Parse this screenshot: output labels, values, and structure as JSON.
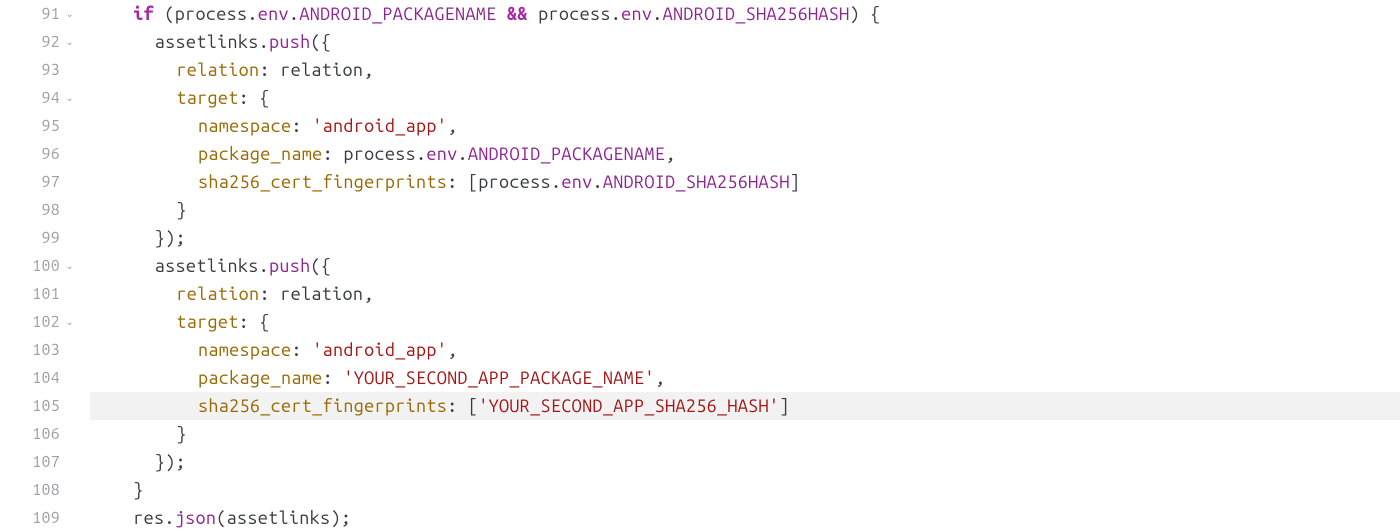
{
  "editor": {
    "highlighted_line": 105,
    "lines": [
      {
        "num": 91,
        "foldable": true,
        "indent": 4,
        "tokens": [
          {
            "t": "if",
            "c": "tok-kw"
          },
          {
            "t": " (",
            "c": "tok-pun"
          },
          {
            "t": "process",
            "c": "tok-id"
          },
          {
            "t": ".",
            "c": "tok-pun"
          },
          {
            "t": "env",
            "c": "tok-prop"
          },
          {
            "t": ".",
            "c": "tok-pun"
          },
          {
            "t": "ANDROID_PACKAGENAME",
            "c": "tok-env"
          },
          {
            "t": " ",
            "c": "tok-pun"
          },
          {
            "t": "&&",
            "c": "tok-op"
          },
          {
            "t": " ",
            "c": "tok-pun"
          },
          {
            "t": "process",
            "c": "tok-id"
          },
          {
            "t": ".",
            "c": "tok-pun"
          },
          {
            "t": "env",
            "c": "tok-prop"
          },
          {
            "t": ".",
            "c": "tok-pun"
          },
          {
            "t": "ANDROID_SHA256HASH",
            "c": "tok-env"
          },
          {
            "t": ") {",
            "c": "tok-pun"
          }
        ]
      },
      {
        "num": 92,
        "foldable": true,
        "indent": 6,
        "tokens": [
          {
            "t": "assetlinks",
            "c": "tok-id"
          },
          {
            "t": ".",
            "c": "tok-pun"
          },
          {
            "t": "push",
            "c": "tok-method"
          },
          {
            "t": "({",
            "c": "tok-pun"
          }
        ]
      },
      {
        "num": 93,
        "foldable": false,
        "indent": 8,
        "tokens": [
          {
            "t": "relation",
            "c": "tok-attr"
          },
          {
            "t": ": ",
            "c": "tok-pun"
          },
          {
            "t": "relation",
            "c": "tok-id"
          },
          {
            "t": ",",
            "c": "tok-pun"
          }
        ]
      },
      {
        "num": 94,
        "foldable": true,
        "indent": 8,
        "tokens": [
          {
            "t": "target",
            "c": "tok-attr"
          },
          {
            "t": ": {",
            "c": "tok-pun"
          }
        ]
      },
      {
        "num": 95,
        "foldable": false,
        "indent": 10,
        "tokens": [
          {
            "t": "namespace",
            "c": "tok-attr"
          },
          {
            "t": ": ",
            "c": "tok-pun"
          },
          {
            "t": "'android_app'",
            "c": "tok-str"
          },
          {
            "t": ",",
            "c": "tok-pun"
          }
        ]
      },
      {
        "num": 96,
        "foldable": false,
        "indent": 10,
        "tokens": [
          {
            "t": "package_name",
            "c": "tok-attr"
          },
          {
            "t": ": ",
            "c": "tok-pun"
          },
          {
            "t": "process",
            "c": "tok-id"
          },
          {
            "t": ".",
            "c": "tok-pun"
          },
          {
            "t": "env",
            "c": "tok-prop"
          },
          {
            "t": ".",
            "c": "tok-pun"
          },
          {
            "t": "ANDROID_PACKAGENAME",
            "c": "tok-env"
          },
          {
            "t": ",",
            "c": "tok-pun"
          }
        ]
      },
      {
        "num": 97,
        "foldable": false,
        "indent": 10,
        "tokens": [
          {
            "t": "sha256_cert_fingerprints",
            "c": "tok-attr"
          },
          {
            "t": ": [",
            "c": "tok-pun"
          },
          {
            "t": "process",
            "c": "tok-id"
          },
          {
            "t": ".",
            "c": "tok-pun"
          },
          {
            "t": "env",
            "c": "tok-prop"
          },
          {
            "t": ".",
            "c": "tok-pun"
          },
          {
            "t": "ANDROID_SHA256HASH",
            "c": "tok-env"
          },
          {
            "t": "]",
            "c": "tok-pun"
          }
        ]
      },
      {
        "num": 98,
        "foldable": false,
        "indent": 8,
        "tokens": [
          {
            "t": "}",
            "c": "tok-pun"
          }
        ]
      },
      {
        "num": 99,
        "foldable": false,
        "indent": 6,
        "tokens": [
          {
            "t": "});",
            "c": "tok-pun"
          }
        ]
      },
      {
        "num": 100,
        "foldable": true,
        "indent": 6,
        "tokens": [
          {
            "t": "assetlinks",
            "c": "tok-id"
          },
          {
            "t": ".",
            "c": "tok-pun"
          },
          {
            "t": "push",
            "c": "tok-method"
          },
          {
            "t": "({",
            "c": "tok-pun"
          }
        ]
      },
      {
        "num": 101,
        "foldable": false,
        "indent": 8,
        "tokens": [
          {
            "t": "relation",
            "c": "tok-attr"
          },
          {
            "t": ": ",
            "c": "tok-pun"
          },
          {
            "t": "relation",
            "c": "tok-id"
          },
          {
            "t": ",",
            "c": "tok-pun"
          }
        ]
      },
      {
        "num": 102,
        "foldable": true,
        "indent": 8,
        "tokens": [
          {
            "t": "target",
            "c": "tok-attr"
          },
          {
            "t": ": {",
            "c": "tok-pun"
          }
        ]
      },
      {
        "num": 103,
        "foldable": false,
        "indent": 10,
        "tokens": [
          {
            "t": "namespace",
            "c": "tok-attr"
          },
          {
            "t": ": ",
            "c": "tok-pun"
          },
          {
            "t": "'android_app'",
            "c": "tok-str"
          },
          {
            "t": ",",
            "c": "tok-pun"
          }
        ]
      },
      {
        "num": 104,
        "foldable": false,
        "indent": 10,
        "tokens": [
          {
            "t": "package_name",
            "c": "tok-attr"
          },
          {
            "t": ": ",
            "c": "tok-pun"
          },
          {
            "t": "'YOUR_SECOND_APP_PACKAGE_NAME'",
            "c": "tok-str"
          },
          {
            "t": ",",
            "c": "tok-pun"
          }
        ]
      },
      {
        "num": 105,
        "foldable": false,
        "indent": 10,
        "tokens": [
          {
            "t": "sha256_cert_fingerprints",
            "c": "tok-attr"
          },
          {
            "t": ": [",
            "c": "tok-pun"
          },
          {
            "t": "'YOUR_SECOND_APP_SHA256_HASH'",
            "c": "tok-str"
          },
          {
            "t": "]",
            "c": "tok-pun"
          }
        ]
      },
      {
        "num": 106,
        "foldable": false,
        "indent": 8,
        "tokens": [
          {
            "t": "}",
            "c": "tok-pun"
          }
        ]
      },
      {
        "num": 107,
        "foldable": false,
        "indent": 6,
        "tokens": [
          {
            "t": "});",
            "c": "tok-pun"
          }
        ]
      },
      {
        "num": 108,
        "foldable": false,
        "indent": 4,
        "tokens": [
          {
            "t": "}",
            "c": "tok-pun"
          }
        ]
      },
      {
        "num": 109,
        "foldable": false,
        "indent": 4,
        "tokens": [
          {
            "t": "res",
            "c": "tok-id"
          },
          {
            "t": ".",
            "c": "tok-pun"
          },
          {
            "t": "json",
            "c": "tok-method"
          },
          {
            "t": "(",
            "c": "tok-pun"
          },
          {
            "t": "assetlinks",
            "c": "tok-id"
          },
          {
            "t": ");",
            "c": "tok-pun"
          }
        ]
      }
    ]
  },
  "glyphs": {
    "fold_open": "⌄"
  }
}
